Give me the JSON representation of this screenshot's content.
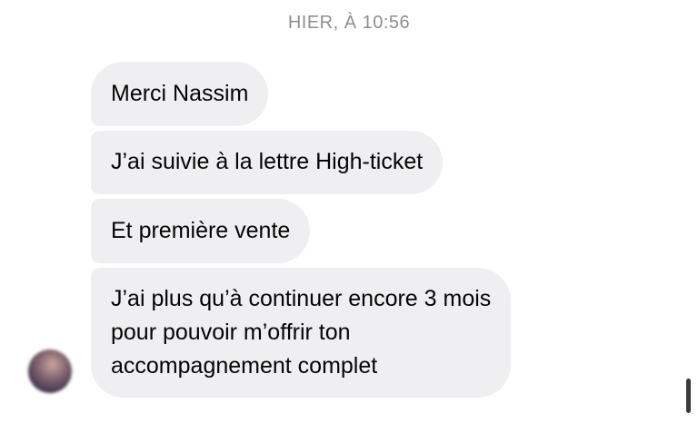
{
  "thread": {
    "timestamp": "HIER, À 10:56",
    "messages": [
      {
        "lines": [
          "Merci Nassim"
        ]
      },
      {
        "lines": [
          "J’ai suivie à la lettre High-ticket"
        ]
      },
      {
        "lines": [
          "Et première vente"
        ]
      },
      {
        "lines": [
          "J’ai plus qu’à continuer encore 3 mois",
          "pour pouvoir m’offrir ton",
          "accompagnement complet"
        ]
      }
    ]
  },
  "colors": {
    "bubble_bg": "#efeff1",
    "text": "#050505",
    "timestamp": "#8e8e93"
  },
  "icons": {
    "avatar": "user-avatar",
    "scrollbar": "vertical-scrollbar"
  }
}
